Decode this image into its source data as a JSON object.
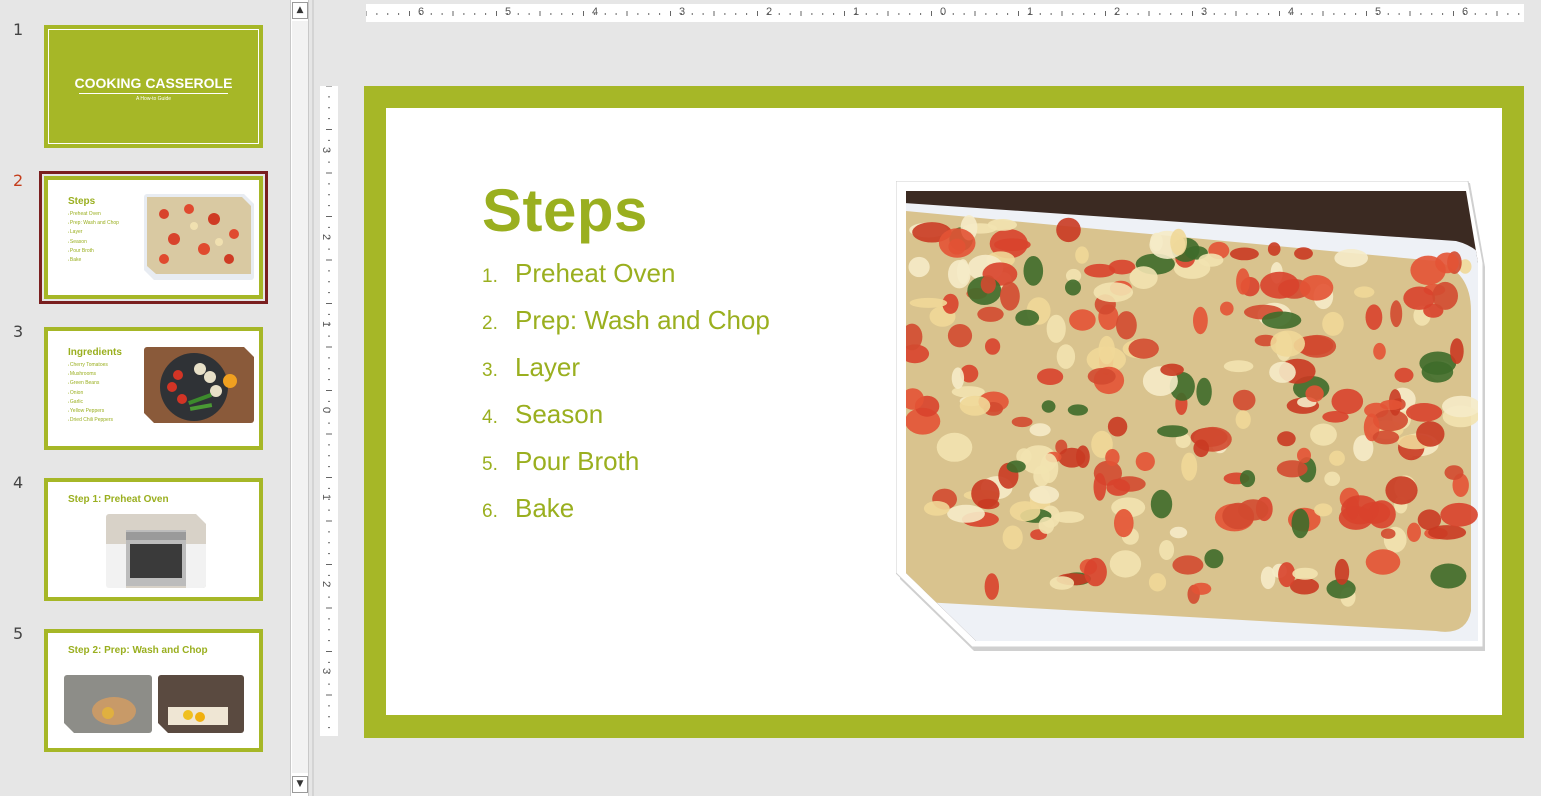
{
  "thumbnails": [
    {
      "number": "1",
      "title": "COOKING CASSEROLE",
      "subtitle": "A How-to Guide"
    },
    {
      "number": "2",
      "title": "Steps",
      "items": [
        "Preheat Oven",
        "Prep: Wash and Chop",
        "Layer",
        "Season",
        "Pour Broth",
        "Bake"
      ]
    },
    {
      "number": "3",
      "title": "Ingredients",
      "items": [
        "Cherry Tomatoes",
        "Mushrooms",
        "Green Beans",
        "Onion",
        "Garlic",
        "Yellow Peppers",
        "Dried Chili Peppers"
      ]
    },
    {
      "number": "4",
      "title": "Step 1: Preheat Oven"
    },
    {
      "number": "5",
      "title": "Step 2: Prep: Wash and Chop"
    }
  ],
  "selected_slide": 2,
  "ruler": {
    "horizontal": [
      "6",
      "5",
      "4",
      "3",
      "2",
      "1",
      "0",
      "1",
      "2",
      "3",
      "4",
      "5",
      "6"
    ],
    "vertical": [
      "3",
      "2",
      "1",
      "0",
      "1",
      "2",
      "3"
    ]
  },
  "slide": {
    "title": "Steps",
    "steps": [
      {
        "num": "1.",
        "text": "Preheat Oven"
      },
      {
        "num": "2.",
        "text": "Prep: Wash and Chop"
      },
      {
        "num": "3.",
        "text": "Layer"
      },
      {
        "num": "4.",
        "text": "Season"
      },
      {
        "num": "5.",
        "text": "Pour Broth"
      },
      {
        "num": "6.",
        "text": "Bake"
      }
    ]
  },
  "colors": {
    "accent": "#a6b727",
    "text_accent": "#9aaf1f",
    "selection": "#7a1f1f",
    "active_number": "#c43e1c"
  },
  "icons": {
    "scroll_up": "▲",
    "scroll_down": "▼"
  }
}
